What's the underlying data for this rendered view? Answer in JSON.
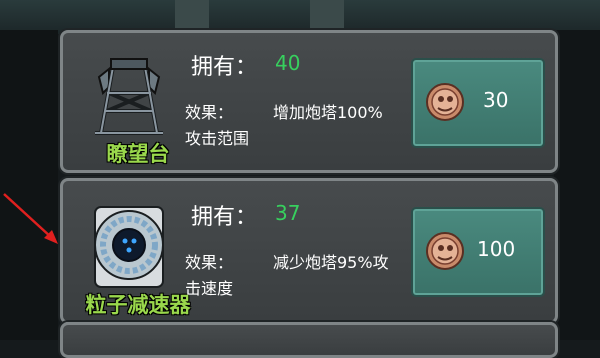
{
  "items": [
    {
      "name": "瞭望台",
      "icon": "watchtower-icon",
      "owned_label": "拥有：",
      "owned_value": "40",
      "effect_label": "效果：",
      "effect_text": "增加炮塔100%",
      "effect_cont": "攻击范围",
      "price": "30",
      "coin_icon": "zombie-coin-icon"
    },
    {
      "name": "粒子减速器",
      "icon": "particle-decelerator-icon",
      "owned_label": "拥有：",
      "owned_value": "37",
      "effect_label": "效果：",
      "effect_text": "减少炮塔95%攻",
      "effect_cont": "击速度",
      "price": "100",
      "coin_icon": "zombie-coin-icon"
    }
  ],
  "colors": {
    "name": "#9ad84c",
    "owned_value": "#37d05e",
    "button": "#3f7d73",
    "card": "#404446"
  }
}
